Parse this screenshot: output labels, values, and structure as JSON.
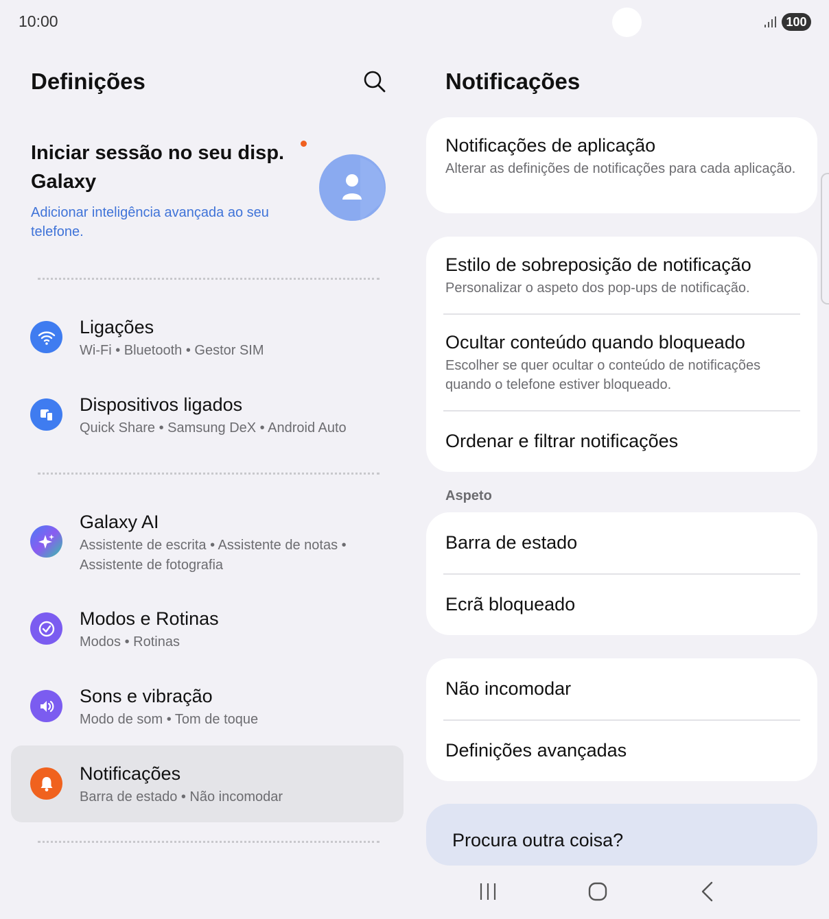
{
  "status_bar": {
    "time": "10:00",
    "battery": "100"
  },
  "left": {
    "title": "Definições",
    "account": {
      "title": "Iniciar sessão no seu disp. Galaxy",
      "subtitle": "Adicionar inteligência avançada ao seu telefone."
    },
    "items": [
      {
        "title": "Ligações",
        "subtitle": "Wi-Fi  •  Bluetooth  •  Gestor SIM",
        "icon": "wifi-icon",
        "color": "#3f7cf0"
      },
      {
        "title": "Dispositivos ligados",
        "subtitle": "Quick Share  •  Samsung DeX  •  Android Auto",
        "icon": "devices-icon",
        "color": "#3f7cf0"
      },
      {
        "title": "Galaxy AI",
        "subtitle": "Assistente de escrita  •  Assistente de notas  •  Assistente de fotografia",
        "icon": "sparkle-icon",
        "color": "#5a6cf0"
      },
      {
        "title": "Modos e Rotinas",
        "subtitle": "Modos  •  Rotinas",
        "icon": "check-circle-icon",
        "color": "#7b5cf0"
      },
      {
        "title": "Sons e vibração",
        "subtitle": "Modo de som  •  Tom de toque",
        "icon": "speaker-icon",
        "color": "#7b5cf0"
      },
      {
        "title": "Notificações",
        "subtitle": "Barra de estado  •  Não incomodar",
        "icon": "bell-icon",
        "color": "#f0621e"
      }
    ]
  },
  "right": {
    "title": "Notificações",
    "app_notifications": {
      "title": "Notificações de aplicação",
      "subtitle": "Alterar as definições de notificações para cada aplicação."
    },
    "overlay_style": {
      "title": "Estilo de sobreposição de notificação",
      "subtitle": "Personalizar o aspeto dos pop-ups de notificação."
    },
    "hide_content": {
      "title": "Ocultar conteúdo quando bloqueado",
      "subtitle": "Escolher se quer ocultar o conteúdo de notificações quando o telefone estiver bloqueado."
    },
    "sort_filter": "Ordenar e filtrar notificações",
    "section_aspect": "Aspeto",
    "status_bar": "Barra de estado",
    "lock_screen": "Ecrã bloqueado",
    "dnd": "Não incomodar",
    "advanced": "Definições avançadas",
    "looking_for": "Procura outra coisa?"
  }
}
